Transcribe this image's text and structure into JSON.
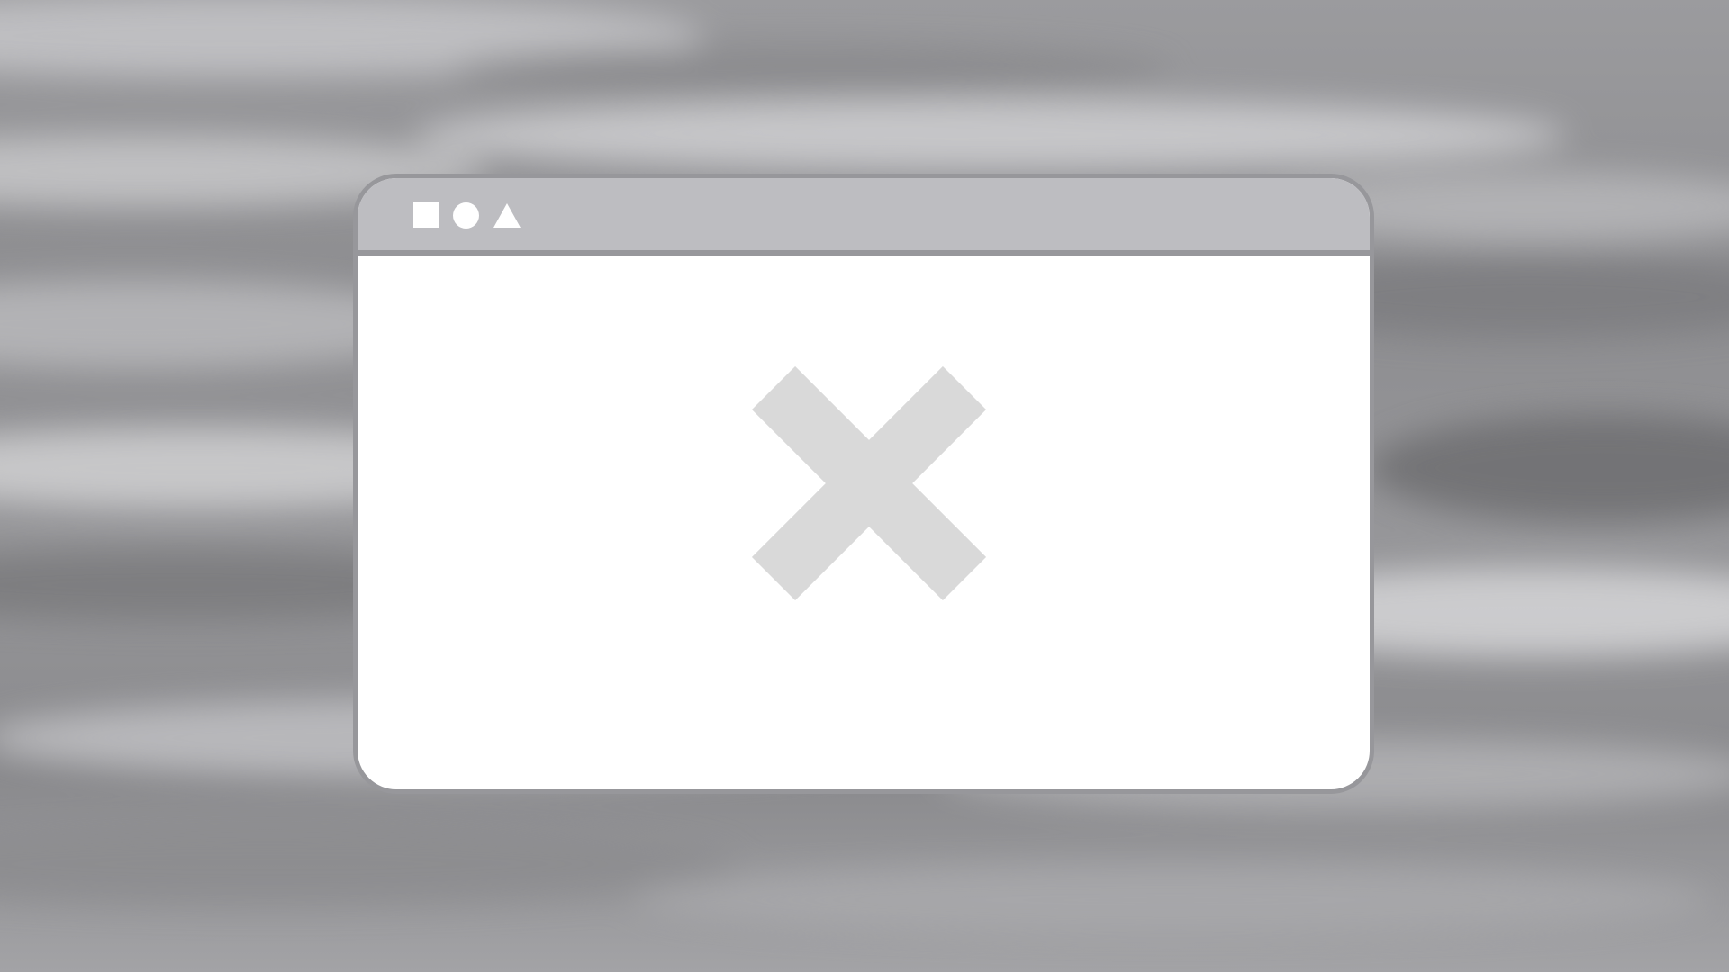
{
  "desktop": {
    "background": "grey-watercolor-wallpaper",
    "colors": {
      "dark": "#7f7f82",
      "mid": "#9a9a9d",
      "light": "#c9c9cb"
    }
  },
  "window": {
    "titlebar": {
      "controls": [
        {
          "icon": "square-icon"
        },
        {
          "icon": "circle-icon"
        },
        {
          "icon": "triangle-icon"
        }
      ],
      "color": "#bdbdc1"
    },
    "border_color": "#97979b",
    "body_color": "#ffffff",
    "content": {
      "icon": "close-x-icon",
      "icon_color": "#d9d9d9",
      "state": "broken-image-placeholder"
    }
  }
}
